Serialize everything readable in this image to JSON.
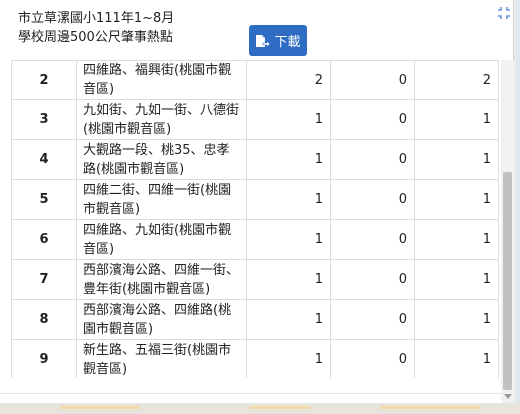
{
  "popup": {
    "title_line1": "市立草漯國小111年1~8月",
    "title_line2": "學校周邊500公尺肇事熱點",
    "download_label": "下載",
    "expand_icon": "expand-icon",
    "download_icon": "download-icon"
  },
  "table": {
    "rows": [
      {
        "num": "2",
        "road": "四維路、福興街(桃園市觀音區)",
        "a": "2",
        "b": "0",
        "c": "2"
      },
      {
        "num": "3",
        "road": "九如街、九如一街、八德街(桃園市觀音區)",
        "a": "1",
        "b": "0",
        "c": "1"
      },
      {
        "num": "4",
        "road": "大觀路一段、桃35、忠孝路(桃園市觀音區)",
        "a": "1",
        "b": "0",
        "c": "1"
      },
      {
        "num": "5",
        "road": "四維二街、四維一街(桃園市觀音區)",
        "a": "1",
        "b": "0",
        "c": "1"
      },
      {
        "num": "6",
        "road": "四維路、九如街(桃園市觀音區)",
        "a": "1",
        "b": "0",
        "c": "1"
      },
      {
        "num": "7",
        "road": "西部濱海公路、四維一街、豊年街(桃園市觀音區)",
        "a": "1",
        "b": "0",
        "c": "1"
      },
      {
        "num": "8",
        "road": "西部濱海公路、四維路(桃園市觀音區)",
        "a": "1",
        "b": "0",
        "c": "1"
      },
      {
        "num": "9",
        "road": "新生路、五福三街(桃園市觀音區)",
        "a": "1",
        "b": "0",
        "c": "1"
      }
    ]
  },
  "colors": {
    "button": "#2f6cc4",
    "border": "#dcdcdc"
  }
}
